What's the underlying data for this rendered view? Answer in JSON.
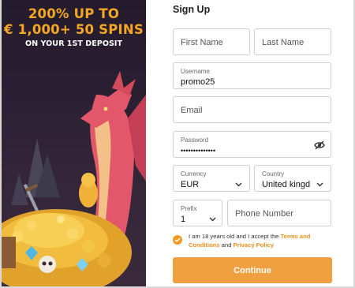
{
  "promo": {
    "line1": "200% UP TO",
    "line2": "€ 1,000+ 50 SPINS",
    "line3": "ON YOUR 1ST DEPOSIT"
  },
  "form": {
    "title": "Sign Up",
    "first_name_placeholder": "First Name",
    "last_name_placeholder": "Last Name",
    "username_label": "Username",
    "username_value": "promo25",
    "email_placeholder": "Email",
    "password_label": "Password",
    "password_value": "••••••••••••••",
    "currency_label": "Currency",
    "currency_value": "EUR",
    "country_label": "Country",
    "country_value": "United kingd",
    "prefix_label": "Prefix",
    "prefix_value": "1",
    "phone_placeholder": "Phone Number",
    "consent_prefix": "I am 18 years old and I accept the ",
    "consent_terms": "Terms and Conditions",
    "consent_and": " and ",
    "consent_privacy": "Privacy Policy",
    "continue_label": "Continue"
  },
  "colors": {
    "accent": "#f1a041",
    "promo_text": "#f5a623",
    "panel_bg": "#2b2033"
  }
}
